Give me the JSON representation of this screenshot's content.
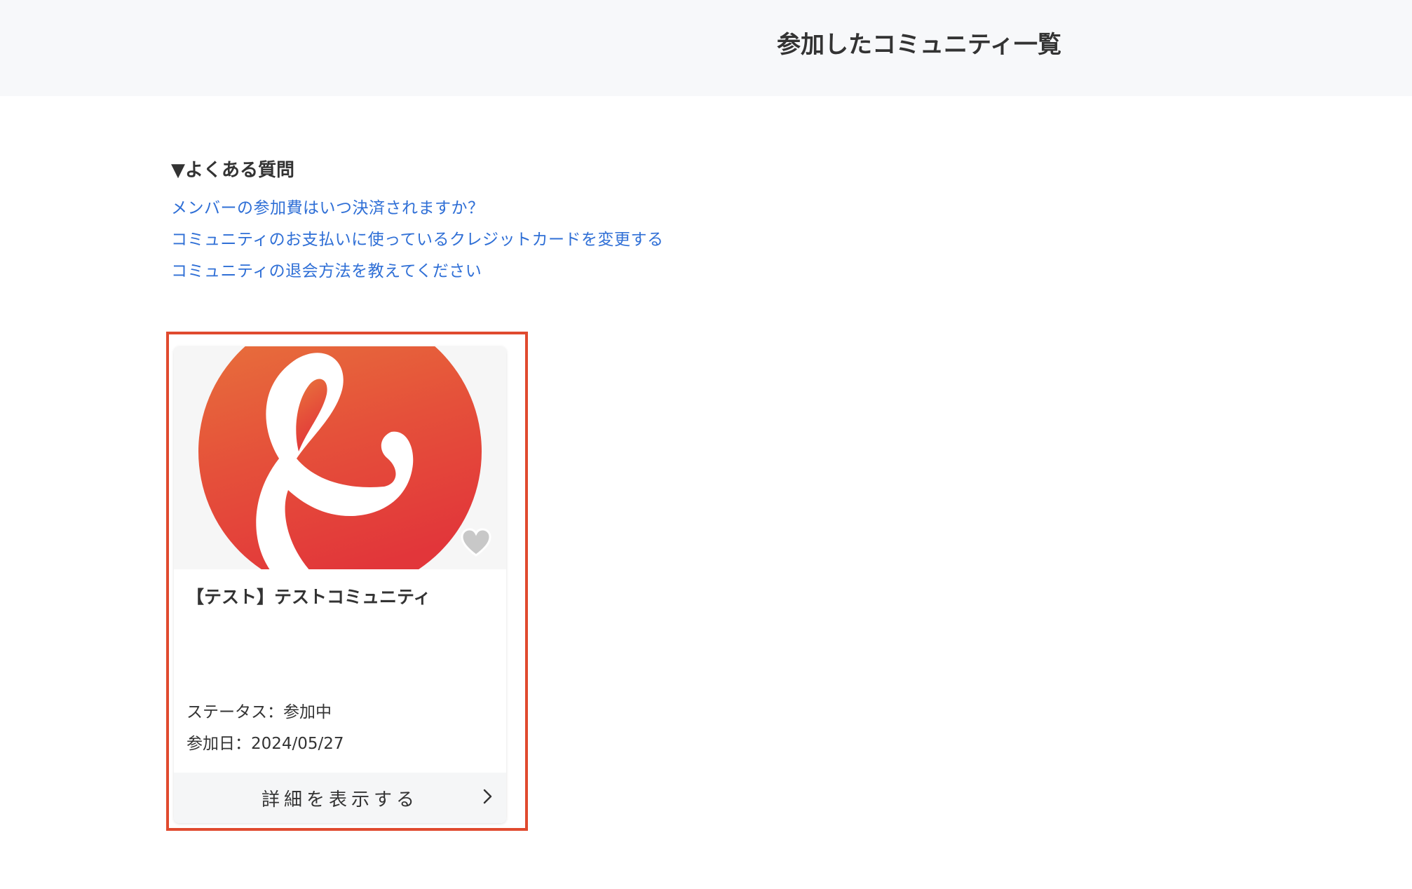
{
  "header": {
    "title": "参加したコミュニティ一覧"
  },
  "faq": {
    "heading": "▼よくある質問",
    "links": [
      "メンバーの参加費はいつ決済されますか？",
      "コミュニティのお支払いに使っているクレジットカードを変更する",
      "コミュニティの退会方法を教えてください"
    ]
  },
  "community_card": {
    "title": "【テスト】テストコミュニティ",
    "status": "ステータス：参加中",
    "joined": "参加日：2024/05/27",
    "detail_label": "詳細を表示する",
    "logo_icon": "ampersand-logo-icon",
    "favorite_icon": "heart-icon",
    "chevron_icon": "chevron-right-icon"
  },
  "colors": {
    "header_bg": "#f7f8fa",
    "link": "#2f6fd6",
    "highlight_border": "#e04a2f",
    "logo_gradient_top": "#e8763c",
    "logo_gradient_bottom": "#e2363a"
  }
}
